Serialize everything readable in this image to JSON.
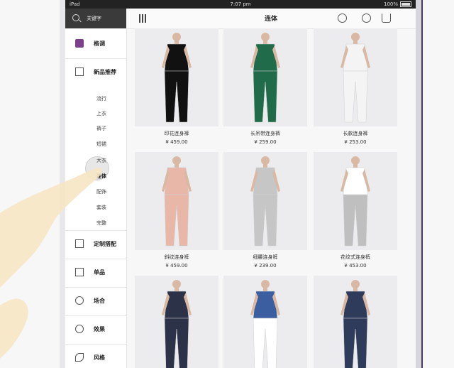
{
  "status_bar": {
    "device": "iPad",
    "time": "7:07 pm",
    "battery": "100%"
  },
  "search": {
    "placeholder": "关键字"
  },
  "sidebar": {
    "top_item": {
      "label": "格调"
    },
    "section": {
      "label": "新品推荐"
    },
    "sub_items": [
      "流行",
      "上衣",
      "裤子",
      "短裙",
      "大衣",
      "连体",
      "配饰",
      "套装",
      "完整"
    ],
    "active_sub": "连体",
    "items": [
      {
        "label": "定制搭配",
        "icon": "custom-icon"
      },
      {
        "label": "单品",
        "icon": "item-icon"
      },
      {
        "label": "场合",
        "icon": "occasion-icon"
      },
      {
        "label": "效果",
        "icon": "effect-icon"
      },
      {
        "label": "风格",
        "icon": "style-icon"
      }
    ]
  },
  "header": {
    "title": "连体",
    "icons": [
      "menu-icon",
      "clock-icon",
      "user-icon",
      "cart-icon"
    ]
  },
  "products": [
    {
      "name": "印花连身裤",
      "price": "¥ 459.00",
      "top": "#111111",
      "bottom": "#111111"
    },
    {
      "name": "长吊带连身裤",
      "price": "¥ 259.00",
      "top": "#1f6b4a",
      "bottom": "#1f6b4a"
    },
    {
      "name": "长款连身裤",
      "price": "¥ 253.00",
      "top": "#f4f4f4",
      "bottom": "#f4f4f4"
    },
    {
      "name": "斜纹连身裤",
      "price": "¥ 459.00",
      "top": "#e8b7a8",
      "bottom": "#e8b7a8"
    },
    {
      "name": "细腰连身裤",
      "price": "¥ 239.00",
      "top": "#c6c6c6",
      "bottom": "#c6c6c6"
    },
    {
      "name": "花纹式连身裤",
      "price": "¥ 453.00",
      "top": "#ffffff",
      "bottom": "#bfbfbf"
    },
    {
      "name": "",
      "price": "",
      "top": "#2c3248",
      "bottom": "#2c3248"
    },
    {
      "name": "",
      "price": "",
      "top": "#3b5ea0",
      "bottom": "#ffffff"
    },
    {
      "name": "",
      "price": "",
      "top": "#2f3b5a",
      "bottom": "#2f3b5a"
    }
  ]
}
